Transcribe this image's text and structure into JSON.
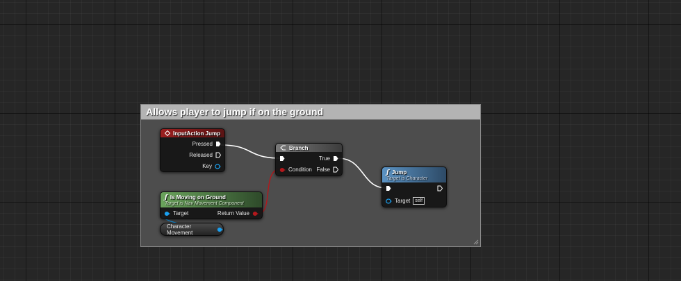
{
  "comment": {
    "title": "Allows player to jump if on the ground"
  },
  "nodes": {
    "input_action": {
      "title": "InputAction Jump",
      "pins": {
        "pressed": "Pressed",
        "released": "Released",
        "key": "Key"
      }
    },
    "branch": {
      "title": "Branch",
      "pins": {
        "condition": "Condition",
        "true": "True",
        "false": "False"
      }
    },
    "jump": {
      "title": "Jump",
      "subtitle": "Target is Character",
      "pins": {
        "target": "Target",
        "target_default": "self"
      }
    },
    "is_moving_on_ground": {
      "title": "Is Moving on Ground",
      "subtitle": "Target is Nav Movement Component",
      "pins": {
        "target": "Target",
        "return_value": "Return Value"
      }
    },
    "character_movement": {
      "title": "Character Movement"
    }
  },
  "colors": {
    "event_header": "#8c1c1c",
    "function_header": "#4f87b8",
    "pure_function_header": "#5f9e52",
    "exec_wire": "#ffffff",
    "bool_pin": "#b3181c",
    "object_pin": "#1aa0f0"
  },
  "icons": {
    "event": "diamond-icon",
    "branch": "branch-icon",
    "function": "function-icon",
    "exec_pin": "exec-pin-icon",
    "data_pin": "circle-pin-icon"
  }
}
